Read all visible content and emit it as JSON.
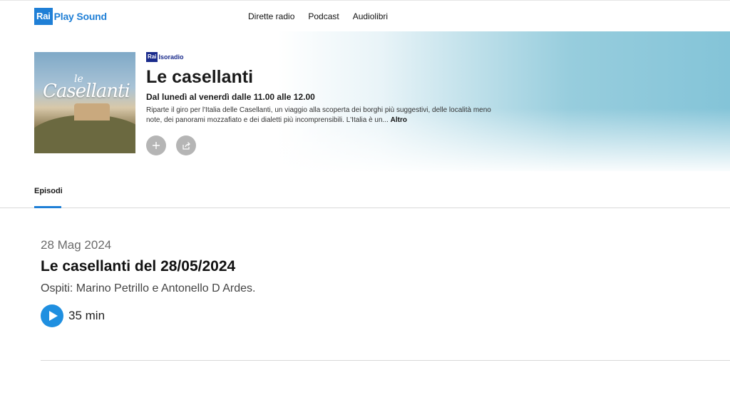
{
  "brand": {
    "rai": "Rai",
    "name": "Play Sound",
    "color": "#1f7fd6"
  },
  "nav": [
    {
      "label": "Dirette radio"
    },
    {
      "label": "Podcast"
    },
    {
      "label": "Audiolibri"
    }
  ],
  "show": {
    "channel_rai": "Rai",
    "channel_name": "Isoradio",
    "cover_small": "le",
    "cover_text": "Casellanti",
    "title": "Le casellanti",
    "schedule": "Dal lunedì al venerdì dalle 11.00 alle 12.00",
    "description": "Riparte il giro per l'Italia delle Casellanti, un viaggio alla scoperta dei borghi più suggestivi, delle località meno note, dei panorami mozzafiato e dei dialetti più incomprensibili. L'Italia è un...",
    "more_label": "Altro",
    "add_icon": "plus-icon",
    "share_icon": "share-icon"
  },
  "tabs": [
    {
      "label": "Episodi",
      "active": true
    }
  ],
  "episode": {
    "date": "28 Mag 2024",
    "title": "Le casellanti del 28/05/2024",
    "description": "Ospiti: Marino Petrillo e Antonello D Ardes.",
    "duration": "35 min",
    "play_icon": "play-icon"
  }
}
